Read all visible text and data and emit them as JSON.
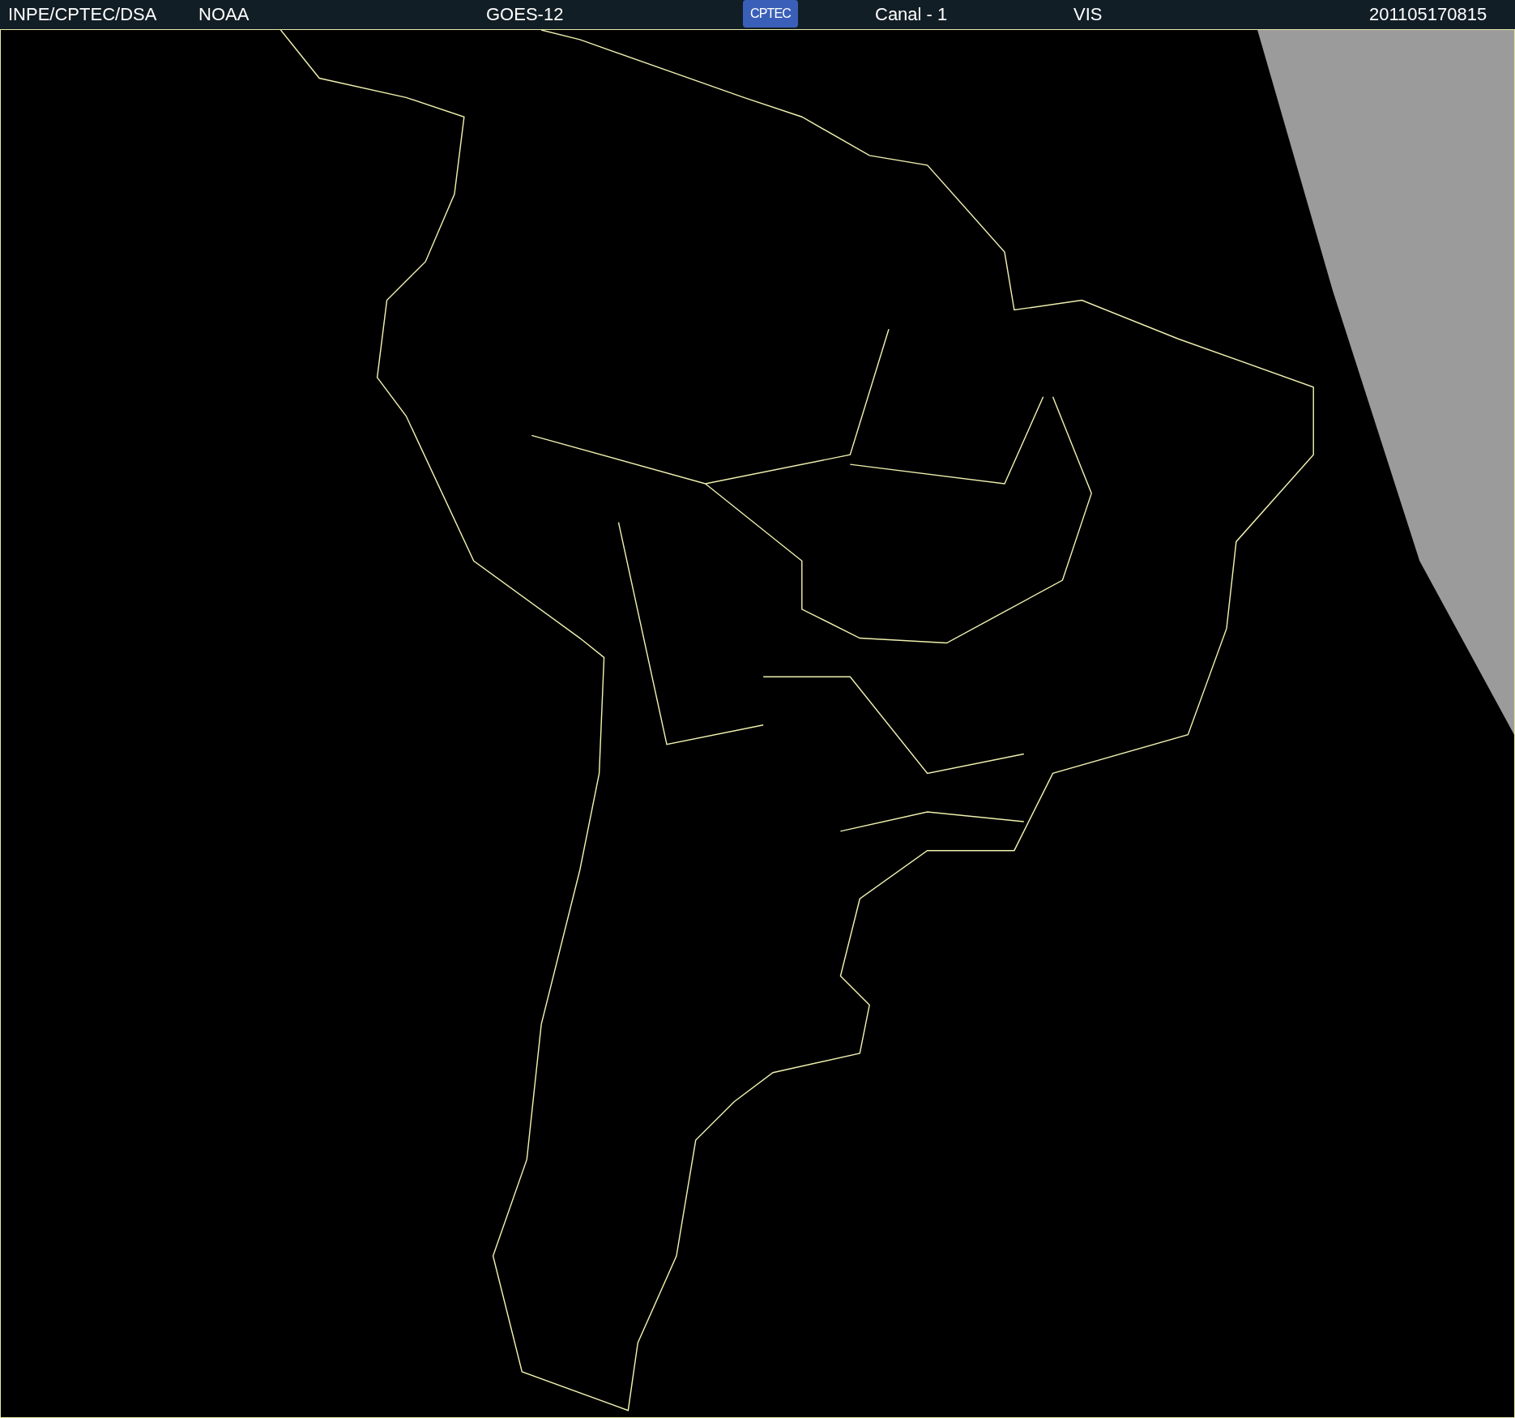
{
  "header": {
    "items": [
      {
        "kind": "text",
        "text": "INPE/CPTEC/DSA"
      },
      {
        "kind": "text",
        "text": "NOAA"
      },
      {
        "kind": "text",
        "text": "GOES-12"
      },
      {
        "kind": "logo",
        "text": "CPTEC"
      },
      {
        "kind": "text",
        "text": "Canal - 1"
      },
      {
        "kind": "text",
        "text": "VIS"
      },
      {
        "kind": "text",
        "text": "201105170815"
      }
    ]
  }
}
